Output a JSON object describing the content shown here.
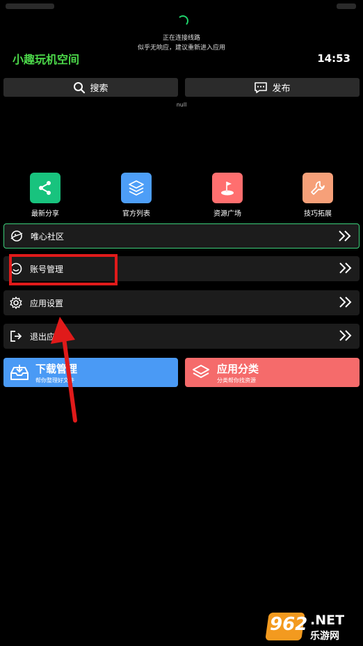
{
  "connection": {
    "title": "正在连接线路",
    "subtitle": "似乎无响应，建议重新进入应用"
  },
  "header": {
    "app_title": "小趣玩机空间",
    "time": "14:53"
  },
  "top_buttons": {
    "search": "搜索",
    "publish": "发布"
  },
  "null_text": "null",
  "tiles": [
    {
      "label": "最新分享",
      "icon": "share-icon",
      "color": "#18c37e"
    },
    {
      "label": "官方列表",
      "icon": "layers-icon",
      "color": "#4d9ef7"
    },
    {
      "label": "资源广场",
      "icon": "flag-icon",
      "color": "#ff6f6f"
    },
    {
      "label": "技巧拓展",
      "icon": "wrench-icon",
      "color": "#f6a079"
    }
  ],
  "menu": [
    {
      "label": "唯心社区",
      "icon": "planet-icon"
    },
    {
      "label": "账号管理",
      "icon": "smile-icon"
    },
    {
      "label": "应用设置",
      "icon": "gear-icon"
    },
    {
      "label": "退出应",
      "icon": "logout-icon"
    }
  ],
  "cards": {
    "download": {
      "title": "下载管理",
      "subtitle": "帮你整理好文件",
      "color": "#4a9af5"
    },
    "category": {
      "title": "应用分类",
      "subtitle": "分类帮你找资源",
      "color": "#f56b6b"
    }
  },
  "watermark": {
    "number": "962",
    "suffix": ".NET",
    "site": "乐游网"
  }
}
